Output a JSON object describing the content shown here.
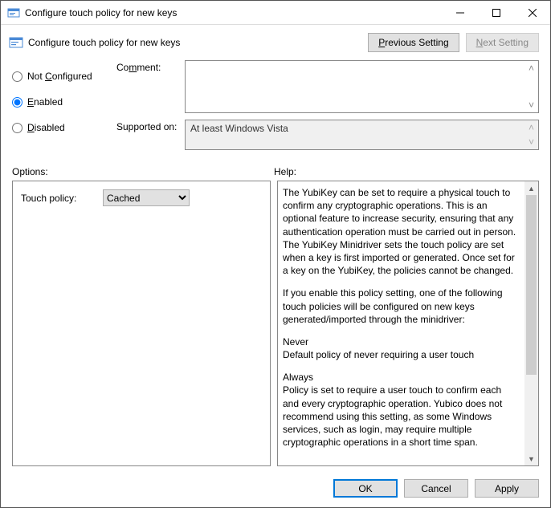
{
  "window": {
    "title": "Configure touch policy for new keys"
  },
  "header": {
    "title": "Configure touch policy for new keys",
    "prev_mnemonic": "P",
    "prev_rest": "revious Setting",
    "next_mnemonic": "N",
    "next_rest": "ext Setting"
  },
  "config": {
    "not_configured_mnemonic": "C",
    "not_configured_rest": "onfigured",
    "not_configured_prefix": "Not ",
    "enabled_mnemonic": "E",
    "enabled_rest": "nabled",
    "disabled_mnemonic": "D",
    "disabled_rest": "isabled",
    "selected": "enabled",
    "comment_mnemonic": "m",
    "comment_prefix": "Co",
    "comment_suffix": "ment:",
    "comment_value": "",
    "supported_label": "Supported on:",
    "supported_value": "At least Windows Vista"
  },
  "labels": {
    "options": "Options:",
    "help": "Help:"
  },
  "options": {
    "touch_policy_label": "Touch policy:",
    "touch_policy_value": "Cached"
  },
  "help": {
    "p1": "The YubiKey can be set to require a physical touch to confirm any cryptographic operations. This is an optional feature to increase security, ensuring that any authentication operation must be carried out in person. The YubiKey Minidriver sets the touch policy are set when a key is first imported or generated. Once set for a key on the YubiKey, the policies cannot be changed.",
    "p2": "If you enable this policy setting, one of the following touch policies will be configured on new keys generated/imported through the minidriver:",
    "never_title": "Never",
    "never_body": "Default policy of never requiring a user touch",
    "always_title": "Always",
    "always_body": "Policy is set to require a user touch to confirm each and every cryptographic operation. Yubico does not recommend using this setting, as some Windows services, such as login, may require multiple cryptographic operations in a short time span."
  },
  "footer": {
    "ok": "OK",
    "cancel": "Cancel",
    "apply_mnemonic": "A",
    "apply_rest": "pply"
  }
}
